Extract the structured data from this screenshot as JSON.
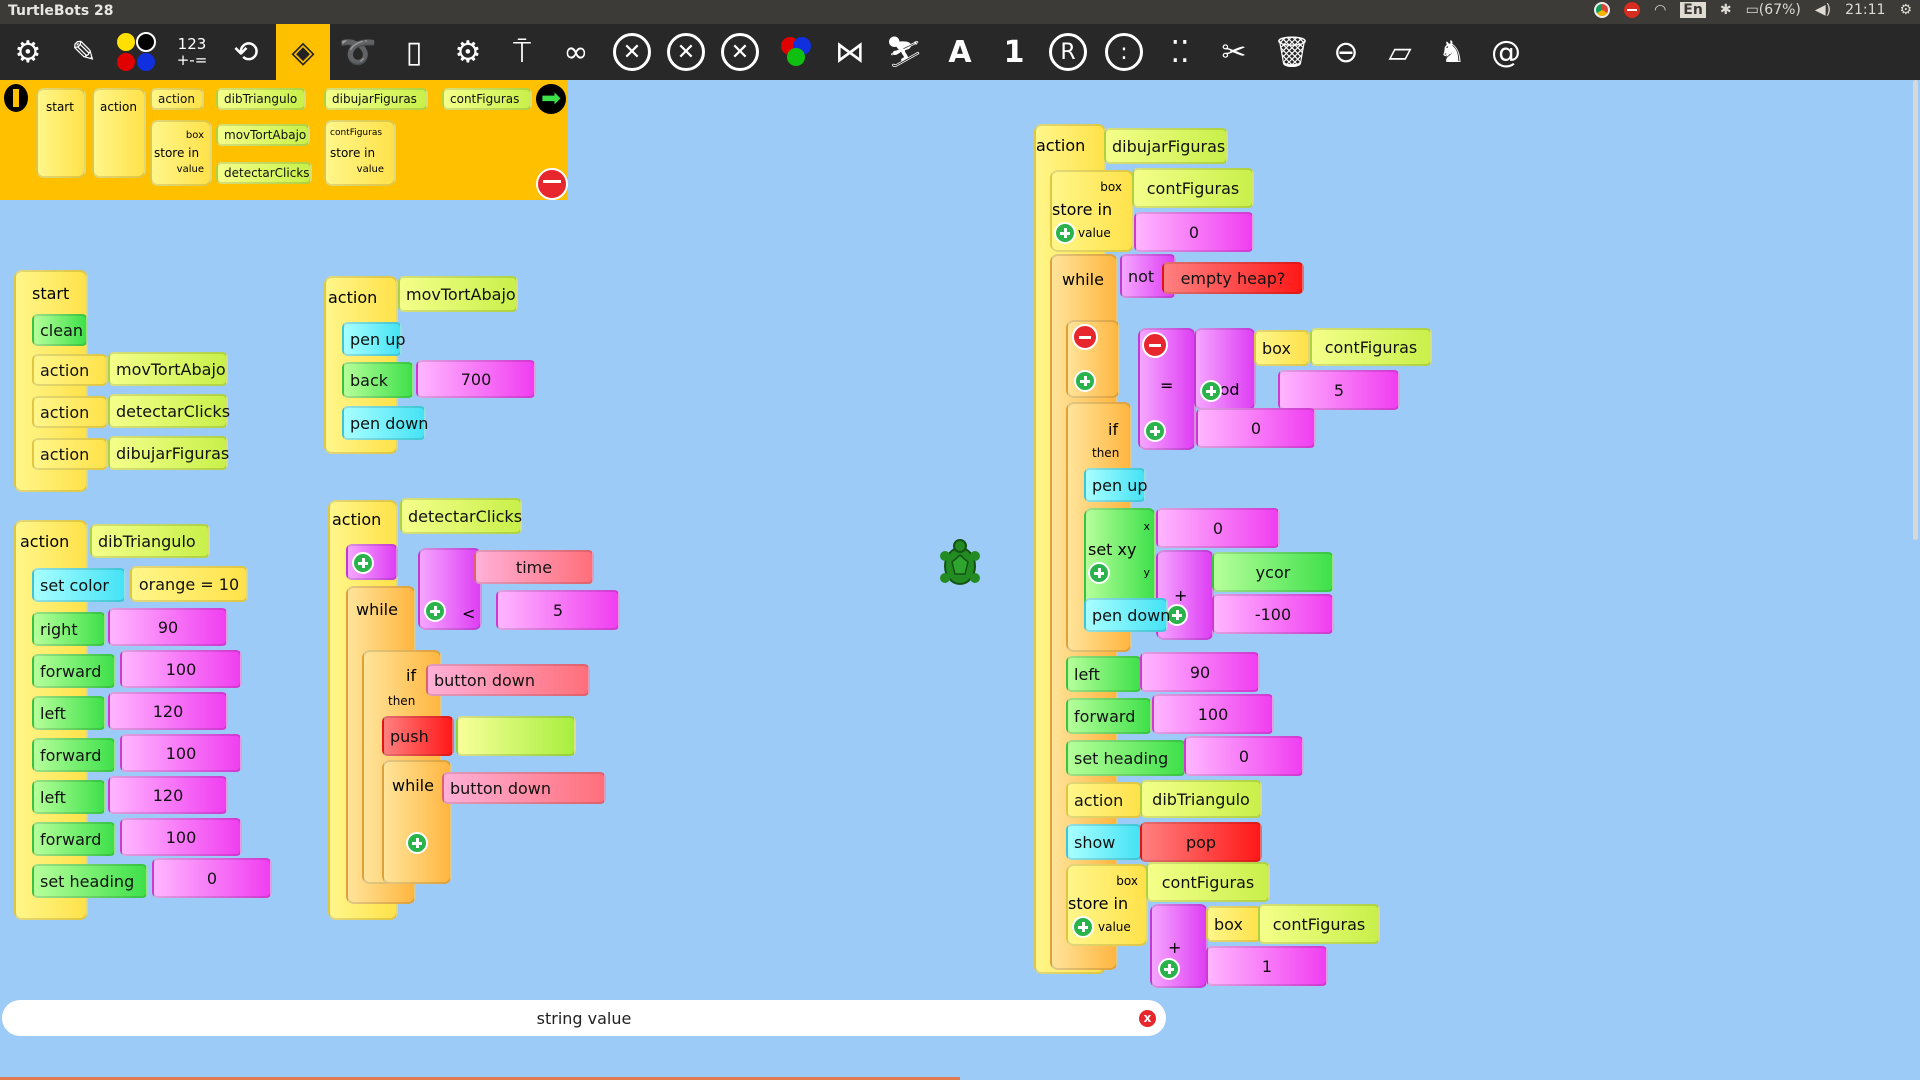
{
  "window": {
    "title": "TurtleBots 28"
  },
  "tray": {
    "keyboard": "En",
    "battery": "(67%)",
    "clock": "21:11"
  },
  "toolbar": {
    "number_label_top": "123",
    "number_label_bottom": "+-=",
    "icons": [
      "turtle-icon",
      "pen-icon",
      "colors-icon",
      "numbers-icon",
      "flow-icon",
      "blocks-icon",
      "sensors-icon",
      "media-icon",
      "settings-icon",
      "presentation-icon",
      "loop-icon",
      "cancel-icon",
      "cancel-e-icon",
      "cancel-r-icon",
      "rgb-icon",
      "fish-icon",
      "sledge-icon",
      "font-size-icon",
      "font-size-one-icon",
      "registered-icon",
      "dots-circle-icon",
      "dots-icon",
      "cut-icon",
      "trash-icon",
      "snapshot-icon",
      "eraser-icon",
      "rabbit-icon",
      "snail-icon"
    ]
  },
  "palette": {
    "start": "start",
    "action": "action",
    "box": "box",
    "store_in": "store in",
    "value": "value",
    "items": [
      "action",
      "dibTriangulo",
      "dibujarFiguras",
      "contFiguras",
      "movTortAbajo",
      "detectarClicks",
      "contFiguras"
    ]
  },
  "stack_start": {
    "start": "start",
    "clean": "clean",
    "actions": [
      {
        "label": "action",
        "name": "movTortAbajo"
      },
      {
        "label": "action",
        "name": "detectarClicks"
      },
      {
        "label": "action",
        "name": "dibujarFiguras"
      }
    ]
  },
  "stack_triangle": {
    "action": "action",
    "name": "dibTriangulo",
    "set_color": "set color",
    "color_value": "orange = 10",
    "steps": [
      {
        "cmd": "right",
        "value": "90"
      },
      {
        "cmd": "forward",
        "value": "100"
      },
      {
        "cmd": "left",
        "value": "120"
      },
      {
        "cmd": "forward",
        "value": "100"
      },
      {
        "cmd": "left",
        "value": "120"
      },
      {
        "cmd": "forward",
        "value": "100"
      },
      {
        "cmd": "set heading",
        "value": "0"
      }
    ]
  },
  "stack_move_down": {
    "action": "action",
    "name": "movTortAbajo",
    "pen_up": "pen up",
    "back": "back",
    "back_value": "700",
    "pen_down": "pen down"
  },
  "stack_clicks": {
    "action": "action",
    "name": "detectarClicks",
    "while": "while",
    "less": "<",
    "time": "time",
    "limit": "5",
    "if": "if",
    "then": "then",
    "button_down": "button down",
    "push": "push",
    "push_value": "",
    "while2": "while",
    "button_down2": "button down"
  },
  "stack_figures": {
    "action": "action",
    "name": "dibujarFiguras",
    "box": "box",
    "store_in": "store in",
    "value": "value",
    "box_name": "contFiguras",
    "init_value": "0",
    "while": "while",
    "not": "not",
    "empty_heap": "empty heap?",
    "if": "if",
    "then": "then",
    "equals": "=",
    "mod": "mod",
    "mod_box": "box",
    "mod_box_name": "contFiguras",
    "mod_value": "5",
    "eq_value": "0",
    "pen_up": "pen up",
    "set_xy": "set xy",
    "x": "x",
    "y": "y",
    "x_value": "0",
    "plus": "+",
    "ycor": "ycor",
    "y_offset": "-100",
    "pen_down": "pen down",
    "left": "left",
    "left_value": "90",
    "forward": "forward",
    "forward_value": "100",
    "set_heading": "set heading",
    "heading_value": "0",
    "action2": "action",
    "action2_name": "dibTriangulo",
    "show": "show",
    "pop": "pop",
    "store2_box": "box",
    "store2_box_name": "contFiguras",
    "store2_label": "store in",
    "store2_value": "value",
    "sum_plus": "+",
    "sum_box": "box",
    "sum_box_name": "contFiguras",
    "sum_value": "1"
  },
  "status": {
    "text": "string value",
    "close": "x"
  }
}
